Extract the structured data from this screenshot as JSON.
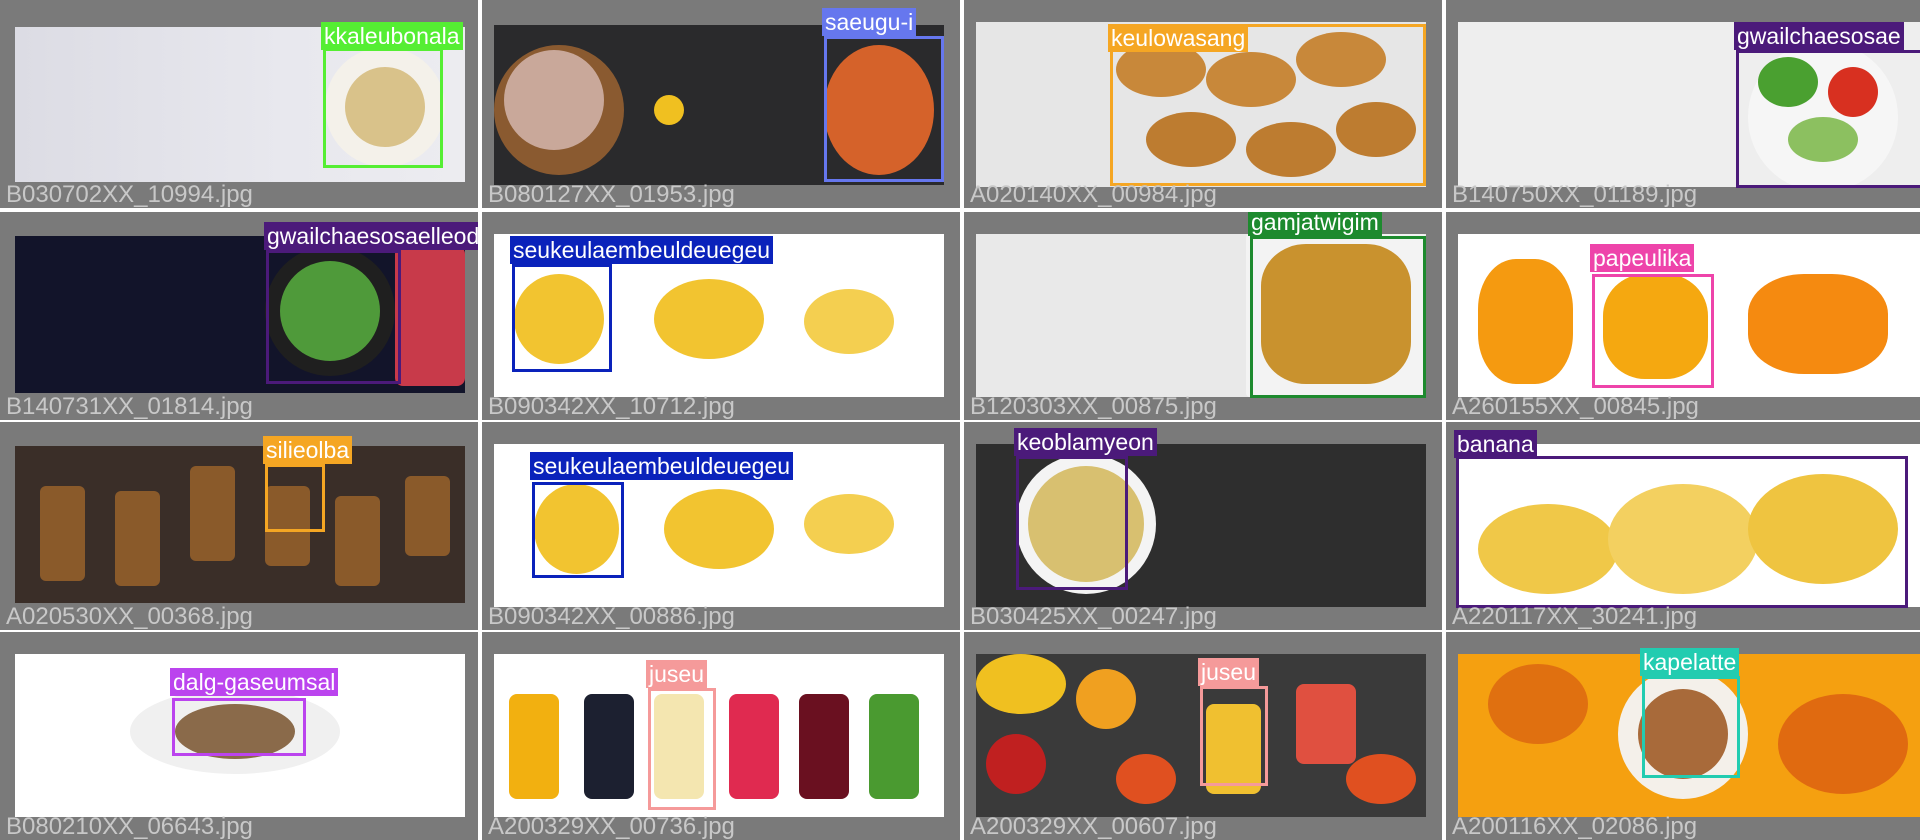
{
  "tiles": [
    {
      "filename": "B030702XX_10994.jpg",
      "labels": [
        {
          "text": "kkaleubonala",
          "color": "#55ee33"
        }
      ]
    },
    {
      "filename": "B080127XX_01953.jpg",
      "labels": [
        {
          "text": "saeugu-i",
          "color": "#6677ee"
        }
      ]
    },
    {
      "filename": "A020140XX_00984.jpg",
      "labels": [
        {
          "text": "keulowasang",
          "color": "#f5a623"
        }
      ]
    },
    {
      "filename": "B140750XX_01189.jpg",
      "labels": [
        {
          "text": "gwailchaesosae",
          "color": "#4b1a7a"
        }
      ]
    },
    {
      "filename": "B140731XX_01814.jpg",
      "labels": [
        {
          "text": "gwailchaesosaelleodeu",
          "color": "#4b1a7a"
        }
      ]
    },
    {
      "filename": "B090342XX_10712.jpg",
      "labels": [
        {
          "text": "seukeulaembeuldeuegeu",
          "color": "#0a22bb"
        }
      ]
    },
    {
      "filename": "B120303XX_00875.jpg",
      "labels": [
        {
          "text": "gamjatwigim",
          "color": "#1d8a2e"
        }
      ]
    },
    {
      "filename": "A260155XX_00845.jpg",
      "labels": [
        {
          "text": "papeulika",
          "color": "#ee44aa"
        }
      ]
    },
    {
      "filename": "A020530XX_00368.jpg",
      "labels": [
        {
          "text": "silieolba",
          "color": "#f5a623"
        }
      ]
    },
    {
      "filename": "B090342XX_00886.jpg",
      "labels": [
        {
          "text": "seukeulaembeuldeuegeu",
          "color": "#0a22bb"
        }
      ]
    },
    {
      "filename": "B030425XX_00247.jpg",
      "labels": [
        {
          "text": "keoblamyeon",
          "color": "#4b1a7a"
        }
      ]
    },
    {
      "filename": "A220117XX_30241.jpg",
      "labels": [
        {
          "text": "banana",
          "color": "#4b1a7a"
        }
      ]
    },
    {
      "filename": "B080210XX_06643.jpg",
      "labels": [
        {
          "text": "dalg-gaseumsal",
          "color": "#bb44ee"
        }
      ]
    },
    {
      "filename": "A200329XX_00736.jpg",
      "labels": [
        {
          "text": "juseu",
          "color": "#f59a9a"
        }
      ]
    },
    {
      "filename": "A200329XX_00607.jpg",
      "labels": [
        {
          "text": "juseu",
          "color": "#f59a9a"
        }
      ]
    },
    {
      "filename": "A200116XX_02086.jpg",
      "labels": [
        {
          "text": "kapelatte",
          "color": "#22ccb0"
        }
      ]
    }
  ]
}
